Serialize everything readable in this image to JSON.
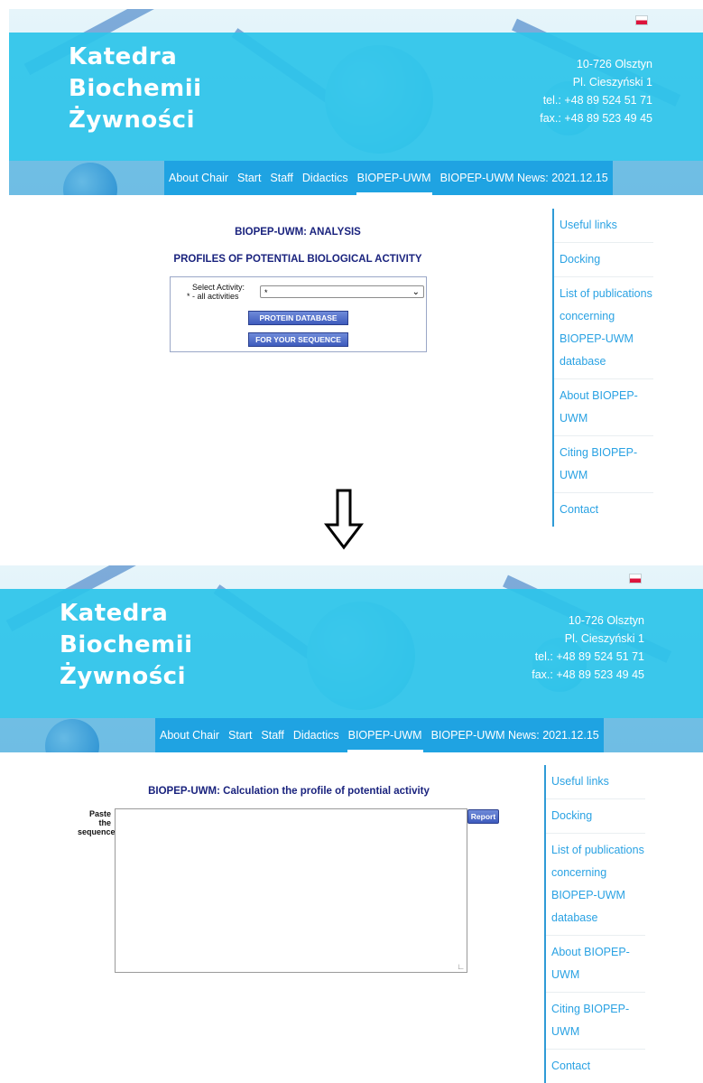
{
  "header": {
    "brand_lines": [
      "Katedra",
      "Biochemii",
      "Żywności"
    ],
    "address_lines": [
      "10-726 Olsztyn",
      "Pl. Cieszyński 1",
      "tel.: +48 89 524 51 71",
      "fax.: +48 89 523 49 45"
    ],
    "nav": [
      "About Chair",
      "Start",
      "Staff",
      "Didactics",
      "BIOPEP-UWM",
      "BIOPEP-UWM News: 2021.12.15"
    ],
    "active_nav": "BIOPEP-UWM"
  },
  "sidebar": {
    "links": [
      "Useful links",
      "Docking",
      "List of publications concerning BIOPEP-UWM database",
      "About BIOPEP-UWM",
      "Citing BIOPEP-UWM",
      "Contact"
    ]
  },
  "analysis_page": {
    "title": "BIOPEP-UWM: ANALYSIS",
    "subtitle": "PROFILES OF POTENTIAL BIOLOGICAL ACTIVITY",
    "select_label": "Select Activity:",
    "select_hint": "* - all activities",
    "select_value": "*",
    "protein_db_button": "PROTEIN DATABASE",
    "your_sequence_button": "FOR YOUR SEQUENCE"
  },
  "calc_page": {
    "title": "BIOPEP-UWM: Calculation the profile of potential activity",
    "paste_label_1": "Paste the",
    "paste_label_2": "sequence:",
    "textarea_value": "",
    "report_button": "Report"
  },
  "colors": {
    "banner_band": "#2dc4e9",
    "menu_bg": "#1fa3e2",
    "sidebar_link": "#2aa2e3",
    "heading": "#1a237e",
    "button": "#3e5bbd"
  },
  "icons": [
    "down-arrow-icon",
    "chevron-down-icon",
    "poland-flag-icon",
    "resize-grip-icon"
  ]
}
